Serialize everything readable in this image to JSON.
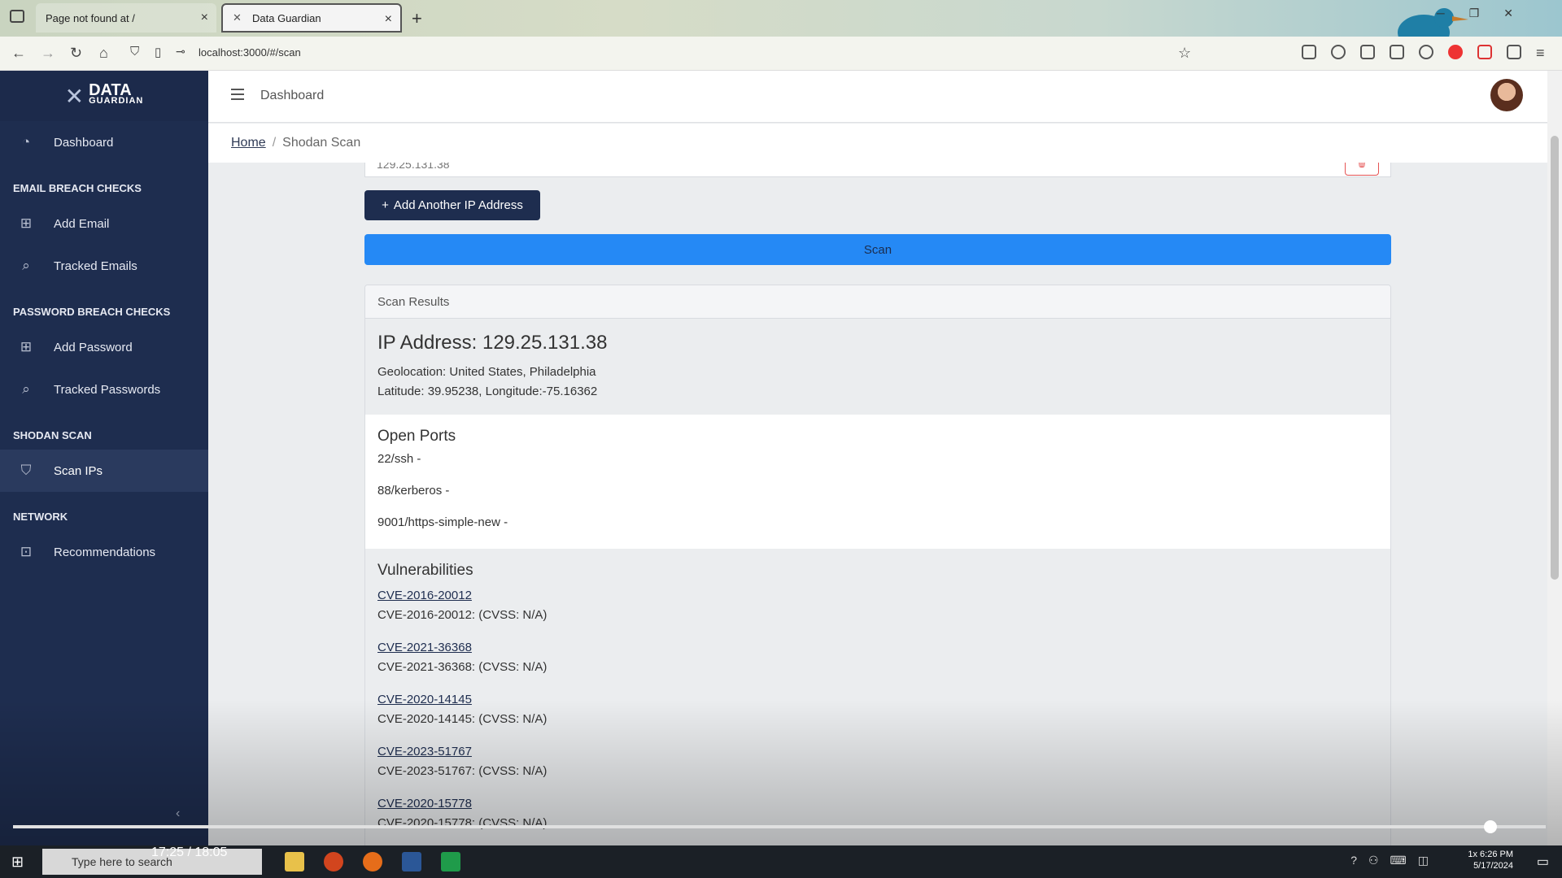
{
  "browser": {
    "tabs": [
      {
        "label": "Page not found at /"
      },
      {
        "label": "Data Guardian"
      }
    ],
    "url": "localhost:3000/#/scan"
  },
  "brand": {
    "line1": "DATA",
    "line2": "GUARDIAN"
  },
  "sidebar": {
    "dashboard": "Dashboard",
    "sections": [
      {
        "title": "EMAIL BREACH CHECKS",
        "items": [
          "Add Email",
          "Tracked Emails"
        ]
      },
      {
        "title": "PASSWORD BREACH CHECKS",
        "items": [
          "Add Password",
          "Tracked Passwords"
        ]
      },
      {
        "title": "SHODAN SCAN",
        "items": [
          "Scan IPs"
        ]
      },
      {
        "title": "NETWORK",
        "items": [
          "Recommendations"
        ]
      }
    ]
  },
  "header": {
    "title": "Dashboard"
  },
  "breadcrumb": {
    "home": "Home",
    "current": "Shodan Scan"
  },
  "form": {
    "ip_value": "129.25.131.38",
    "add_button": "Add Another IP Address",
    "scan_button": "Scan"
  },
  "results": {
    "card_title": "Scan Results",
    "ip_title": "IP Address: 129.25.131.38",
    "geolocation": "Geolocation: United States, Philadelphia",
    "coords": "Latitude: 39.95238, Longitude:-75.16362",
    "ports_title": "Open Ports",
    "ports": [
      "22/ssh -",
      "88/kerberos -",
      "9001/https-simple-new -"
    ],
    "vulns_title": "Vulnerabilities",
    "vulns": [
      {
        "id": "CVE-2016-20012",
        "desc": "CVE-2016-20012: (CVSS: N/A)"
      },
      {
        "id": "CVE-2021-36368",
        "desc": "CVE-2021-36368: (CVSS: N/A)"
      },
      {
        "id": "CVE-2020-14145",
        "desc": "CVE-2020-14145: (CVSS: N/A)"
      },
      {
        "id": "CVE-2023-51767",
        "desc": "CVE-2023-51767: (CVSS: N/A)"
      },
      {
        "id": "CVE-2020-15778",
        "desc": "CVE-2020-15778: (CVSS: N/A)"
      }
    ]
  },
  "video": {
    "time": "17:25 / 18:05",
    "progress": 0.964,
    "speed": "1x"
  },
  "taskbar": {
    "search_placeholder": "Type here to search",
    "clock": "6:26 PM",
    "date": "5/17/2024"
  },
  "colors": {
    "sidebar": "#1e2d4f",
    "accent": "#2589f5",
    "primary_button": "#1e2d4f",
    "danger": "#e55353"
  }
}
